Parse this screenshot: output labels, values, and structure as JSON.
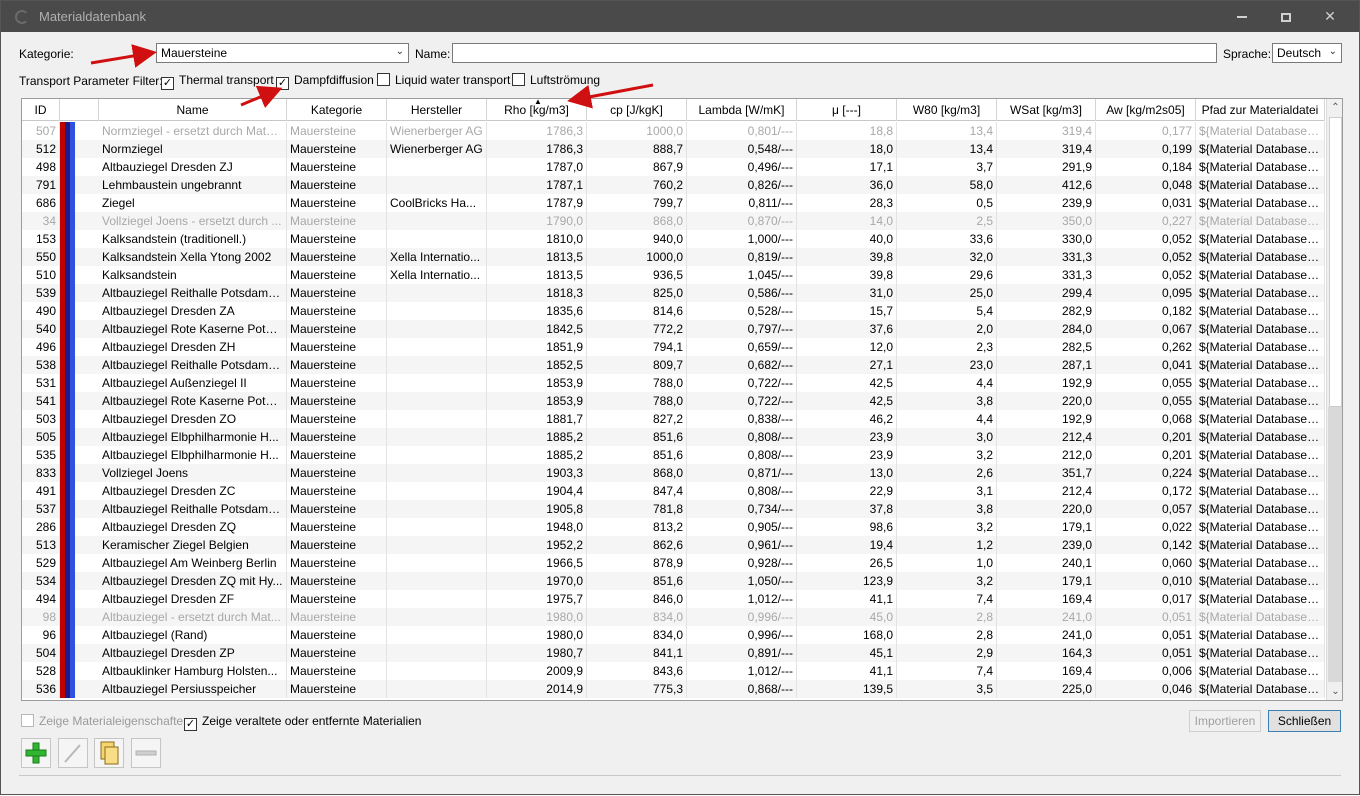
{
  "window": {
    "title": "Materialdatenbank"
  },
  "filter": {
    "kategorie_label": "Kategorie:",
    "kategorie_value": "Mauersteine",
    "name_label": "Name:",
    "name_value": "",
    "sprache_label": "Sprache:",
    "sprache_value": "Deutsch",
    "transport_label": "Transport Parameter Filter:",
    "checkboxes": [
      {
        "label": "Thermal transport",
        "checked": true
      },
      {
        "label": "Dampfdiffusion",
        "checked": true
      },
      {
        "label": "Liquid water transport",
        "checked": false
      },
      {
        "label": "Luftströmung",
        "checked": false
      }
    ]
  },
  "table": {
    "headers": [
      "ID",
      "Name",
      "Kategorie",
      "Hersteller",
      "Rho [kg/m3]",
      "cp [J/kgK]",
      "Lambda [W/mK]",
      "μ [---]",
      "W80 [kg/m3]",
      "WSat [kg/m3]",
      "Aw [kg/m2s05]",
      "Pfad zur Materialdatei"
    ],
    "sorted_column": "Rho [kg/m3]",
    "rows": [
      {
        "id": "507",
        "name": "Normziegel - ersetzt durch Materi...",
        "kat": "Mauersteine",
        "herst": "Wienerberger AG",
        "rho": "1786,3",
        "cp": "1000,0",
        "lambda": "0,801/---",
        "mu": "18,8",
        "w80": "13,4",
        "wsat": "319,4",
        "aw": "0,177",
        "pfad": "${Material Database}...",
        "gray": true
      },
      {
        "id": "512",
        "name": "Normziegel",
        "kat": "Mauersteine",
        "herst": "Wienerberger AG",
        "rho": "1786,3",
        "cp": "888,7",
        "lambda": "0,548/---",
        "mu": "18,0",
        "w80": "13,4",
        "wsat": "319,4",
        "aw": "0,199",
        "pfad": "${Material Database}...",
        "gray": false
      },
      {
        "id": "498",
        "name": "Altbauziegel Dresden ZJ",
        "kat": "Mauersteine",
        "herst": "",
        "rho": "1787,0",
        "cp": "867,9",
        "lambda": "0,496/---",
        "mu": "17,1",
        "w80": "3,7",
        "wsat": "291,9",
        "aw": "0,184",
        "pfad": "${Material Database}...",
        "gray": false
      },
      {
        "id": "791",
        "name": "Lehmbaustein ungebrannt",
        "kat": "Mauersteine",
        "herst": "",
        "rho": "1787,1",
        "cp": "760,2",
        "lambda": "0,826/---",
        "mu": "36,0",
        "w80": "58,0",
        "wsat": "412,6",
        "aw": "0,048",
        "pfad": "${Material Database}...",
        "gray": false
      },
      {
        "id": "686",
        "name": "Ziegel",
        "kat": "Mauersteine",
        "herst": "CoolBricks Ha...",
        "rho": "1787,9",
        "cp": "799,7",
        "lambda": "0,811/---",
        "mu": "28,3",
        "w80": "0,5",
        "wsat": "239,9",
        "aw": "0,031",
        "pfad": "${Material Database}...",
        "gray": false
      },
      {
        "id": "34",
        "name": "Vollziegel Joens - ersetzt durch ...",
        "kat": "Mauersteine",
        "herst": "",
        "rho": "1790,0",
        "cp": "868,0",
        "lambda": "0,870/---",
        "mu": "14,0",
        "w80": "2,5",
        "wsat": "350,0",
        "aw": "0,227",
        "pfad": "${Material Database}...",
        "gray": true
      },
      {
        "id": "153",
        "name": "Kalksandstein (traditionell.)",
        "kat": "Mauersteine",
        "herst": "",
        "rho": "1810,0",
        "cp": "940,0",
        "lambda": "1,000/---",
        "mu": "40,0",
        "w80": "33,6",
        "wsat": "330,0",
        "aw": "0,052",
        "pfad": "${Material Database}...",
        "gray": false
      },
      {
        "id": "550",
        "name": "Kalksandstein Xella Ytong 2002",
        "kat": "Mauersteine",
        "herst": "Xella Internatio...",
        "rho": "1813,5",
        "cp": "1000,0",
        "lambda": "0,819/---",
        "mu": "39,8",
        "w80": "32,0",
        "wsat": "331,3",
        "aw": "0,052",
        "pfad": "${Material Database}...",
        "gray": false
      },
      {
        "id": "510",
        "name": "Kalksandstein",
        "kat": "Mauersteine",
        "herst": "Xella Internatio...",
        "rho": "1813,5",
        "cp": "936,5",
        "lambda": "1,045/---",
        "mu": "39,8",
        "w80": "29,6",
        "wsat": "331,3",
        "aw": "0,052",
        "pfad": "${Material Database}...",
        "gray": false
      },
      {
        "id": "539",
        "name": "Altbauziegel Reithalle Potsdam (...",
        "kat": "Mauersteine",
        "herst": "",
        "rho": "1818,3",
        "cp": "825,0",
        "lambda": "0,586/---",
        "mu": "31,0",
        "w80": "25,0",
        "wsat": "299,4",
        "aw": "0,095",
        "pfad": "${Material Database}...",
        "gray": false
      },
      {
        "id": "490",
        "name": "Altbauziegel Dresden ZA",
        "kat": "Mauersteine",
        "herst": "",
        "rho": "1835,6",
        "cp": "814,6",
        "lambda": "0,528/---",
        "mu": "15,7",
        "w80": "5,4",
        "wsat": "282,9",
        "aw": "0,182",
        "pfad": "${Material Database}...",
        "gray": false
      },
      {
        "id": "540",
        "name": "Altbauziegel Rote Kaserne Potsd...",
        "kat": "Mauersteine",
        "herst": "",
        "rho": "1842,5",
        "cp": "772,2",
        "lambda": "0,797/---",
        "mu": "37,6",
        "w80": "2,0",
        "wsat": "284,0",
        "aw": "0,067",
        "pfad": "${Material Database}...",
        "gray": false
      },
      {
        "id": "496",
        "name": "Altbauziegel Dresden ZH",
        "kat": "Mauersteine",
        "herst": "",
        "rho": "1851,9",
        "cp": "794,1",
        "lambda": "0,659/---",
        "mu": "12,0",
        "w80": "2,3",
        "wsat": "282,5",
        "aw": "0,262",
        "pfad": "${Material Database}...",
        "gray": false
      },
      {
        "id": "538",
        "name": "Altbauziegel Reithalle Potsdam (...",
        "kat": "Mauersteine",
        "herst": "",
        "rho": "1852,5",
        "cp": "809,7",
        "lambda": "0,682/---",
        "mu": "27,1",
        "w80": "23,0",
        "wsat": "287,1",
        "aw": "0,041",
        "pfad": "${Material Database}...",
        "gray": false
      },
      {
        "id": "531",
        "name": "Altbauziegel Außenziegel II",
        "kat": "Mauersteine",
        "herst": "",
        "rho": "1853,9",
        "cp": "788,0",
        "lambda": "0,722/---",
        "mu": "42,5",
        "w80": "4,4",
        "wsat": "192,9",
        "aw": "0,055",
        "pfad": "${Material Database}...",
        "gray": false
      },
      {
        "id": "541",
        "name": "Altbauziegel Rote Kaserne Potsd...",
        "kat": "Mauersteine",
        "herst": "",
        "rho": "1853,9",
        "cp": "788,0",
        "lambda": "0,722/---",
        "mu": "42,5",
        "w80": "3,8",
        "wsat": "220,0",
        "aw": "0,055",
        "pfad": "${Material Database}...",
        "gray": false
      },
      {
        "id": "503",
        "name": "Altbauziegel Dresden ZO",
        "kat": "Mauersteine",
        "herst": "",
        "rho": "1881,7",
        "cp": "827,2",
        "lambda": "0,838/---",
        "mu": "46,2",
        "w80": "4,4",
        "wsat": "192,9",
        "aw": "0,068",
        "pfad": "${Material Database}...",
        "gray": false
      },
      {
        "id": "505",
        "name": "Altbauziegel Elbphilharmonie H...",
        "kat": "Mauersteine",
        "herst": "",
        "rho": "1885,2",
        "cp": "851,6",
        "lambda": "0,808/---",
        "mu": "23,9",
        "w80": "3,0",
        "wsat": "212,4",
        "aw": "0,201",
        "pfad": "${Material Database}...",
        "gray": false
      },
      {
        "id": "535",
        "name": "Altbauziegel Elbphilharmonie H...",
        "kat": "Mauersteine",
        "herst": "",
        "rho": "1885,2",
        "cp": "851,6",
        "lambda": "0,808/---",
        "mu": "23,9",
        "w80": "3,2",
        "wsat": "212,0",
        "aw": "0,201",
        "pfad": "${Material Database}...",
        "gray": false
      },
      {
        "id": "833",
        "name": "Vollziegel Joens",
        "kat": "Mauersteine",
        "herst": "",
        "rho": "1903,3",
        "cp": "868,0",
        "lambda": "0,871/---",
        "mu": "13,0",
        "w80": "2,6",
        "wsat": "351,7",
        "aw": "0,224",
        "pfad": "${Material Database}...",
        "gray": false
      },
      {
        "id": "491",
        "name": "Altbauziegel Dresden ZC",
        "kat": "Mauersteine",
        "herst": "",
        "rho": "1904,4",
        "cp": "847,4",
        "lambda": "0,808/---",
        "mu": "22,9",
        "w80": "3,1",
        "wsat": "212,4",
        "aw": "0,172",
        "pfad": "${Material Database}...",
        "gray": false
      },
      {
        "id": "537",
        "name": "Altbauziegel Reithalle Potsdam (...",
        "kat": "Mauersteine",
        "herst": "",
        "rho": "1905,8",
        "cp": "781,8",
        "lambda": "0,734/---",
        "mu": "37,8",
        "w80": "3,8",
        "wsat": "220,0",
        "aw": "0,057",
        "pfad": "${Material Database}...",
        "gray": false
      },
      {
        "id": "286",
        "name": "Altbauziegel Dresden ZQ",
        "kat": "Mauersteine",
        "herst": "",
        "rho": "1948,0",
        "cp": "813,2",
        "lambda": "0,905/---",
        "mu": "98,6",
        "w80": "3,2",
        "wsat": "179,1",
        "aw": "0,022",
        "pfad": "${Material Database}...",
        "gray": false
      },
      {
        "id": "513",
        "name": "Keramischer Ziegel Belgien",
        "kat": "Mauersteine",
        "herst": "",
        "rho": "1952,2",
        "cp": "862,6",
        "lambda": "0,961/---",
        "mu": "19,4",
        "w80": "1,2",
        "wsat": "239,0",
        "aw": "0,142",
        "pfad": "${Material Database}...",
        "gray": false
      },
      {
        "id": "529",
        "name": "Altbauziegel Am Weinberg Berlin",
        "kat": "Mauersteine",
        "herst": "",
        "rho": "1966,5",
        "cp": "878,9",
        "lambda": "0,928/---",
        "mu": "26,5",
        "w80": "1,0",
        "wsat": "240,1",
        "aw": "0,060",
        "pfad": "${Material Database}...",
        "gray": false
      },
      {
        "id": "534",
        "name": "Altbauziegel Dresden ZQ mit Hy...",
        "kat": "Mauersteine",
        "herst": "",
        "rho": "1970,0",
        "cp": "851,6",
        "lambda": "1,050/---",
        "mu": "123,9",
        "w80": "3,2",
        "wsat": "179,1",
        "aw": "0,010",
        "pfad": "${Material Database}...",
        "gray": false
      },
      {
        "id": "494",
        "name": "Altbauziegel Dresden ZF",
        "kat": "Mauersteine",
        "herst": "",
        "rho": "1975,7",
        "cp": "846,0",
        "lambda": "1,012/---",
        "mu": "41,1",
        "w80": "7,4",
        "wsat": "169,4",
        "aw": "0,017",
        "pfad": "${Material Database}...",
        "gray": false
      },
      {
        "id": "98",
        "name": "Altbauziegel - ersetzt durch Mat...",
        "kat": "Mauersteine",
        "herst": "",
        "rho": "1980,0",
        "cp": "834,0",
        "lambda": "0,996/---",
        "mu": "45,0",
        "w80": "2,8",
        "wsat": "241,0",
        "aw": "0,051",
        "pfad": "${Material Database}...",
        "gray": true
      },
      {
        "id": "96",
        "name": "Altbauziegel (Rand)",
        "kat": "Mauersteine",
        "herst": "",
        "rho": "1980,0",
        "cp": "834,0",
        "lambda": "0,996/---",
        "mu": "168,0",
        "w80": "2,8",
        "wsat": "241,0",
        "aw": "0,051",
        "pfad": "${Material Database}...",
        "gray": false
      },
      {
        "id": "504",
        "name": "Altbauziegel Dresden ZP",
        "kat": "Mauersteine",
        "herst": "",
        "rho": "1980,7",
        "cp": "841,1",
        "lambda": "0,891/---",
        "mu": "45,1",
        "w80": "2,9",
        "wsat": "164,3",
        "aw": "0,051",
        "pfad": "${Material Database}...",
        "gray": false
      },
      {
        "id": "528",
        "name": "Altbauklinker Hamburg Holsten...",
        "kat": "Mauersteine",
        "herst": "",
        "rho": "2009,9",
        "cp": "843,6",
        "lambda": "1,012/---",
        "mu": "41,1",
        "w80": "7,4",
        "wsat": "169,4",
        "aw": "0,006",
        "pfad": "${Material Database}...",
        "gray": false
      },
      {
        "id": "536",
        "name": "Altbauziegel Persiusspeicher",
        "kat": "Mauersteine",
        "herst": "",
        "rho": "2014,9",
        "cp": "775,3",
        "lambda": "0,868/---",
        "mu": "139,5",
        "w80": "3,5",
        "wsat": "225,0",
        "aw": "0,046",
        "pfad": "${Material Database}...",
        "gray": false
      }
    ]
  },
  "options": {
    "show_properties_label": "Zeige Materialeigenschaften",
    "show_properties_checked": false,
    "show_deprecated_label": "Zeige veraltete oder entfernte Materialien",
    "show_deprecated_checked": true
  },
  "buttons": {
    "import_label": "Importieren",
    "close_label": "Schließen"
  },
  "colors": {
    "accent_red": "#d01010",
    "category_red": "#c00000",
    "category_blue": "#3050e0",
    "titlebar": "#4a4a4a"
  }
}
